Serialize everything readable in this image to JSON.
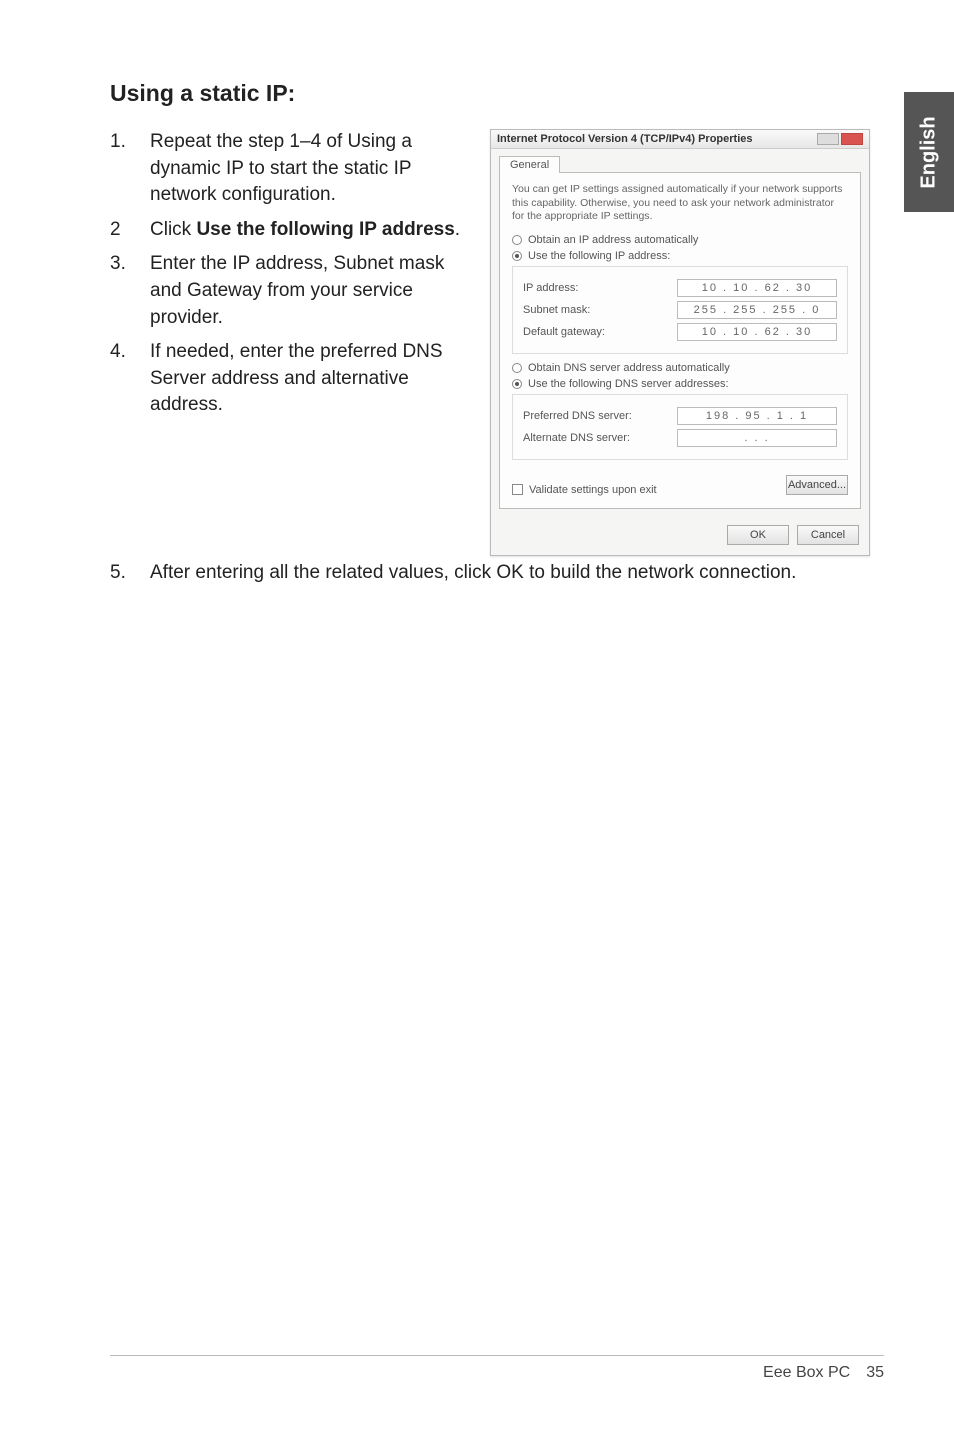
{
  "side_tab": "English",
  "heading": "Using a static IP:",
  "steps_left": [
    {
      "num": "1.",
      "text": "Repeat the step 1–4 of Using a dynamic IP to start the static IP network configuration."
    },
    {
      "num": "2",
      "text_pre": "Click ",
      "bold": "Use the following IP address",
      "text_post": "."
    },
    {
      "num": "3.",
      "text": "Enter the IP address, Subnet mask and Gateway from your service provider."
    },
    {
      "num": "4.",
      "text": "If needed, enter the preferred DNS Server address and alternative address."
    }
  ],
  "steps_full": [
    {
      "num": "5.",
      "text": "After entering all the related values, click OK to build the network connection."
    }
  ],
  "dialog": {
    "title": "Internet Protocol Version 4 (TCP/IPv4) Properties",
    "tab": "General",
    "description": "You can get IP settings assigned automatically if your network supports this capability. Otherwise, you need to ask your network administrator for the appropriate IP settings.",
    "opt_auto_ip": "Obtain an IP address automatically",
    "opt_use_ip": "Use the following IP address:",
    "lbl_ip": "IP address:",
    "val_ip": "10 . 10 . 62 . 30",
    "lbl_mask": "Subnet mask:",
    "val_mask": "255 . 255 . 255 .  0",
    "lbl_gw": "Default gateway:",
    "val_gw": "10 . 10 . 62 . 30",
    "opt_auto_dns": "Obtain DNS server address automatically",
    "opt_use_dns": "Use the following DNS server addresses:",
    "lbl_pdns": "Preferred DNS server:",
    "val_pdns": "198 . 95 .  1 .  1",
    "lbl_adns": "Alternate DNS server:",
    "val_adns": " .     .     .   ",
    "chk_validate": "Validate settings upon exit",
    "btn_adv": "Advanced...",
    "btn_ok": "OK",
    "btn_cancel": "Cancel"
  },
  "footer": {
    "product": "Eee Box PC",
    "page": "35"
  }
}
